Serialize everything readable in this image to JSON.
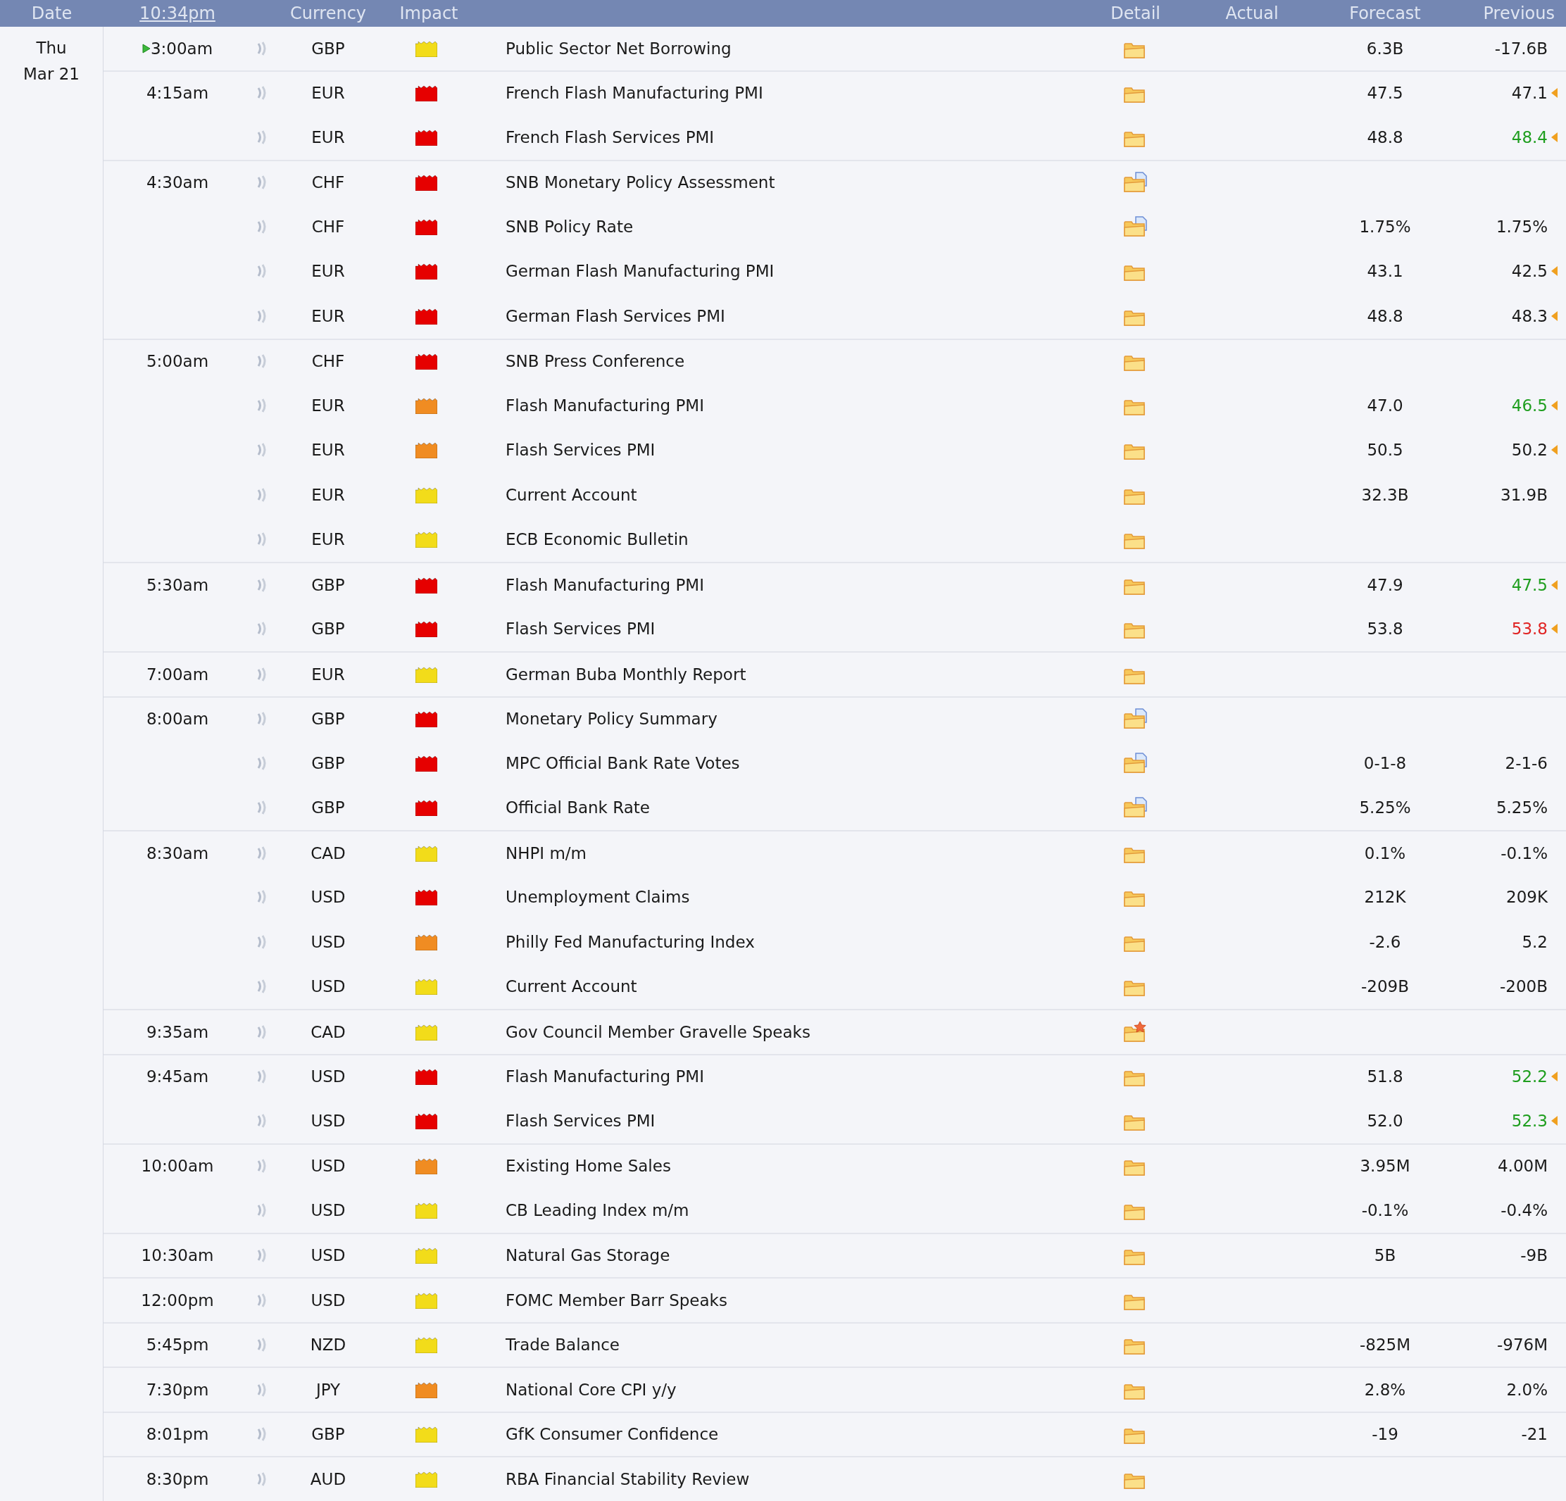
{
  "header": [
    {
      "kind": "date",
      "label": "Date"
    },
    {
      "kind": "clock",
      "label": "10:34pm"
    },
    {
      "kind": "currency",
      "label": "Currency"
    },
    {
      "kind": "impact",
      "label": "Impact"
    },
    {
      "kind": "detail",
      "label": "Detail"
    },
    {
      "kind": "actual",
      "label": "Actual"
    },
    {
      "kind": "forecast",
      "label": "Forecast"
    },
    {
      "kind": "previous",
      "label": "Previous"
    }
  ],
  "day": {
    "weekday": "Thu",
    "date": "Mar 21"
  },
  "groups": [
    {
      "time": "3:00am",
      "upcoming": true,
      "events": [
        {
          "currency": "GBP",
          "impact": {
            "color": "#f2dc1a"
          },
          "title": "Public Sector Net Borrowing",
          "detail": {
            "kind": "folder"
          },
          "forecast": "6.3B",
          "previous": {
            "value": "-17.6B",
            "revised": false,
            "color": "#1a1a1a"
          }
        }
      ]
    },
    {
      "time": "4:15am",
      "upcoming": false,
      "events": [
        {
          "currency": "EUR",
          "impact": {
            "color": "#e60000"
          },
          "title": "French Flash Manufacturing PMI",
          "detail": {
            "kind": "folder"
          },
          "forecast": "47.5",
          "previous": {
            "value": "47.1",
            "revised": true,
            "color": "#1a1a1a"
          }
        },
        {
          "currency": "EUR",
          "impact": {
            "color": "#e60000"
          },
          "title": "French Flash Services PMI",
          "detail": {
            "kind": "folder"
          },
          "forecast": "48.8",
          "previous": {
            "value": "48.4",
            "revised": true,
            "color": "#1f9e1f"
          }
        }
      ]
    },
    {
      "time": "4:30am",
      "upcoming": false,
      "events": [
        {
          "currency": "CHF",
          "impact": {
            "color": "#e60000"
          },
          "title": "SNB Monetary Policy Assessment",
          "detail": {
            "kind": "folder-doc"
          }
        },
        {
          "currency": "CHF",
          "impact": {
            "color": "#e60000"
          },
          "title": "SNB Policy Rate",
          "detail": {
            "kind": "folder-doc"
          },
          "forecast": "1.75%",
          "previous": {
            "value": "1.75%",
            "revised": false,
            "color": "#1a1a1a"
          }
        },
        {
          "currency": "EUR",
          "impact": {
            "color": "#e60000"
          },
          "title": "German Flash Manufacturing PMI",
          "detail": {
            "kind": "folder"
          },
          "forecast": "43.1",
          "previous": {
            "value": "42.5",
            "revised": true,
            "color": "#1a1a1a"
          }
        },
        {
          "currency": "EUR",
          "impact": {
            "color": "#e60000"
          },
          "title": "German Flash Services PMI",
          "detail": {
            "kind": "folder"
          },
          "forecast": "48.8",
          "previous": {
            "value": "48.3",
            "revised": true,
            "color": "#1a1a1a"
          }
        }
      ]
    },
    {
      "time": "5:00am",
      "upcoming": false,
      "events": [
        {
          "currency": "CHF",
          "impact": {
            "color": "#e60000"
          },
          "title": "SNB Press Conference",
          "detail": {
            "kind": "folder"
          }
        },
        {
          "currency": "EUR",
          "impact": {
            "color": "#f08c22"
          },
          "title": "Flash Manufacturing PMI",
          "detail": {
            "kind": "folder"
          },
          "forecast": "47.0",
          "previous": {
            "value": "46.5",
            "revised": true,
            "color": "#1f9e1f"
          }
        },
        {
          "currency": "EUR",
          "impact": {
            "color": "#f08c22"
          },
          "title": "Flash Services PMI",
          "detail": {
            "kind": "folder"
          },
          "forecast": "50.5",
          "previous": {
            "value": "50.2",
            "revised": true,
            "color": "#1a1a1a"
          }
        },
        {
          "currency": "EUR",
          "impact": {
            "color": "#f2dc1a"
          },
          "title": "Current Account",
          "detail": {
            "kind": "folder"
          },
          "forecast": "32.3B",
          "previous": {
            "value": "31.9B",
            "revised": false,
            "color": "#1a1a1a"
          }
        },
        {
          "currency": "EUR",
          "impact": {
            "color": "#f2dc1a"
          },
          "title": "ECB Economic Bulletin",
          "detail": {
            "kind": "folder"
          }
        }
      ]
    },
    {
      "time": "5:30am",
      "upcoming": false,
      "events": [
        {
          "currency": "GBP",
          "impact": {
            "color": "#e60000"
          },
          "title": "Flash Manufacturing PMI",
          "detail": {
            "kind": "folder"
          },
          "forecast": "47.9",
          "previous": {
            "value": "47.5",
            "revised": true,
            "color": "#1f9e1f"
          }
        },
        {
          "currency": "GBP",
          "impact": {
            "color": "#e60000"
          },
          "title": "Flash Services PMI",
          "detail": {
            "kind": "folder"
          },
          "forecast": "53.8",
          "previous": {
            "value": "53.8",
            "revised": true,
            "color": "#e02424"
          }
        }
      ]
    },
    {
      "time": "7:00am",
      "upcoming": false,
      "events": [
        {
          "currency": "EUR",
          "impact": {
            "color": "#f2dc1a"
          },
          "title": "German Buba Monthly Report",
          "detail": {
            "kind": "folder"
          }
        }
      ]
    },
    {
      "time": "8:00am",
      "upcoming": false,
      "events": [
        {
          "currency": "GBP",
          "impact": {
            "color": "#e60000"
          },
          "title": "Monetary Policy Summary",
          "detail": {
            "kind": "folder-doc"
          }
        },
        {
          "currency": "GBP",
          "impact": {
            "color": "#e60000"
          },
          "title": "MPC Official Bank Rate Votes",
          "detail": {
            "kind": "folder-doc"
          },
          "forecast": "0-1-8",
          "previous": {
            "value": "2-1-6",
            "revised": false,
            "color": "#1a1a1a"
          }
        },
        {
          "currency": "GBP",
          "impact": {
            "color": "#e60000"
          },
          "title": "Official Bank Rate",
          "detail": {
            "kind": "folder-doc"
          },
          "forecast": "5.25%",
          "previous": {
            "value": "5.25%",
            "revised": false,
            "color": "#1a1a1a"
          }
        }
      ]
    },
    {
      "time": "8:30am",
      "upcoming": false,
      "events": [
        {
          "currency": "CAD",
          "impact": {
            "color": "#f2dc1a"
          },
          "title": "NHPI m/m",
          "detail": {
            "kind": "folder"
          },
          "forecast": "0.1%",
          "previous": {
            "value": "-0.1%",
            "revised": false,
            "color": "#1a1a1a"
          }
        },
        {
          "currency": "USD",
          "impact": {
            "color": "#e60000"
          },
          "title": "Unemployment Claims",
          "detail": {
            "kind": "folder"
          },
          "forecast": "212K",
          "previous": {
            "value": "209K",
            "revised": false,
            "color": "#1a1a1a"
          }
        },
        {
          "currency": "USD",
          "impact": {
            "color": "#f08c22"
          },
          "title": "Philly Fed Manufacturing Index",
          "detail": {
            "kind": "folder"
          },
          "forecast": "-2.6",
          "previous": {
            "value": "5.2",
            "revised": false,
            "color": "#1a1a1a"
          }
        },
        {
          "currency": "USD",
          "impact": {
            "color": "#f2dc1a"
          },
          "title": "Current Account",
          "detail": {
            "kind": "folder"
          },
          "forecast": "-209B",
          "previous": {
            "value": "-200B",
            "revised": false,
            "color": "#1a1a1a"
          }
        }
      ]
    },
    {
      "time": "9:35am",
      "upcoming": false,
      "events": [
        {
          "currency": "CAD",
          "impact": {
            "color": "#f2dc1a"
          },
          "title": "Gov Council Member Gravelle Speaks",
          "detail": {
            "kind": "folder-star"
          }
        }
      ]
    },
    {
      "time": "9:45am",
      "upcoming": false,
      "events": [
        {
          "currency": "USD",
          "impact": {
            "color": "#e60000"
          },
          "title": "Flash Manufacturing PMI",
          "detail": {
            "kind": "folder"
          },
          "forecast": "51.8",
          "previous": {
            "value": "52.2",
            "revised": true,
            "color": "#1f9e1f"
          }
        },
        {
          "currency": "USD",
          "impact": {
            "color": "#e60000"
          },
          "title": "Flash Services PMI",
          "detail": {
            "kind": "folder"
          },
          "forecast": "52.0",
          "previous": {
            "value": "52.3",
            "revised": true,
            "color": "#1f9e1f"
          }
        }
      ]
    },
    {
      "time": "10:00am",
      "upcoming": false,
      "events": [
        {
          "currency": "USD",
          "impact": {
            "color": "#f08c22"
          },
          "title": "Existing Home Sales",
          "detail": {
            "kind": "folder"
          },
          "forecast": "3.95M",
          "previous": {
            "value": "4.00M",
            "revised": false,
            "color": "#1a1a1a"
          }
        },
        {
          "currency": "USD",
          "impact": {
            "color": "#f2dc1a"
          },
          "title": "CB Leading Index m/m",
          "detail": {
            "kind": "folder"
          },
          "forecast": "-0.1%",
          "previous": {
            "value": "-0.4%",
            "revised": false,
            "color": "#1a1a1a"
          }
        }
      ]
    },
    {
      "time": "10:30am",
      "upcoming": false,
      "events": [
        {
          "currency": "USD",
          "impact": {
            "color": "#f2dc1a"
          },
          "title": "Natural Gas Storage",
          "detail": {
            "kind": "folder"
          },
          "forecast": "5B",
          "previous": {
            "value": "-9B",
            "revised": false,
            "color": "#1a1a1a"
          }
        }
      ]
    },
    {
      "time": "12:00pm",
      "upcoming": false,
      "events": [
        {
          "currency": "USD",
          "impact": {
            "color": "#f2dc1a"
          },
          "title": "FOMC Member Barr Speaks",
          "detail": {
            "kind": "folder"
          }
        }
      ]
    },
    {
      "time": "5:45pm",
      "upcoming": false,
      "events": [
        {
          "currency": "NZD",
          "impact": {
            "color": "#f2dc1a"
          },
          "title": "Trade Balance",
          "detail": {
            "kind": "folder"
          },
          "forecast": "-825M",
          "previous": {
            "value": "-976M",
            "revised": false,
            "color": "#1a1a1a"
          }
        }
      ]
    },
    {
      "time": "7:30pm",
      "upcoming": false,
      "events": [
        {
          "currency": "JPY",
          "impact": {
            "color": "#f08c22"
          },
          "title": "National Core CPI y/y",
          "detail": {
            "kind": "folder"
          },
          "forecast": "2.8%",
          "previous": {
            "value": "2.0%",
            "revised": false,
            "color": "#1a1a1a"
          }
        }
      ]
    },
    {
      "time": "8:01pm",
      "upcoming": false,
      "events": [
        {
          "currency": "GBP",
          "impact": {
            "color": "#f2dc1a"
          },
          "title": "GfK Consumer Confidence",
          "detail": {
            "kind": "folder"
          },
          "forecast": "-19",
          "previous": {
            "value": "-21",
            "revised": false,
            "color": "#1a1a1a"
          }
        }
      ]
    },
    {
      "time": "8:30pm",
      "upcoming": false,
      "events": [
        {
          "currency": "AUD",
          "impact": {
            "color": "#f2dc1a"
          },
          "title": "RBA Financial Stability Review",
          "detail": {
            "kind": "folder"
          }
        }
      ]
    }
  ]
}
